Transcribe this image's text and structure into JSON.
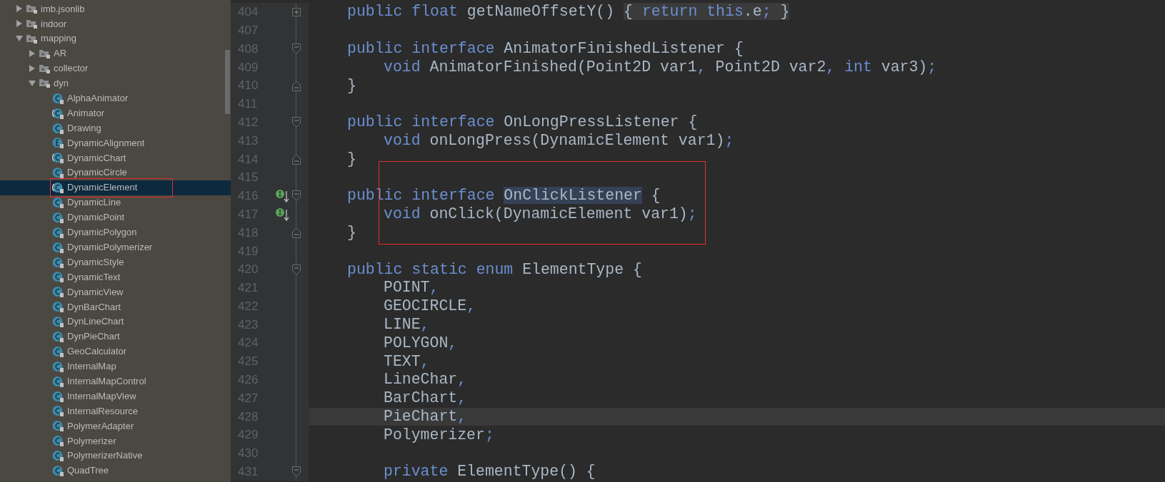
{
  "project_tree": [
    {
      "label": "imb.jsonlib",
      "kind": "package",
      "expanded": false,
      "selected": false,
      "marked": false
    },
    {
      "label": "indoor",
      "kind": "package",
      "expanded": false,
      "selected": false,
      "marked": false
    },
    {
      "label": "mapping",
      "kind": "package",
      "expanded": true,
      "selected": false,
      "marked": false,
      "children": [
        {
          "label": "AR",
          "kind": "package",
          "expanded": false,
          "selected": false,
          "marked": false
        },
        {
          "label": "collector",
          "kind": "package",
          "expanded": false,
          "selected": false,
          "marked": false
        },
        {
          "label": "dyn",
          "kind": "package",
          "expanded": true,
          "selected": false,
          "marked": false,
          "children": [
            {
              "label": "AlphaAnimator",
              "kind": "class",
              "selected": false,
              "marked": false
            },
            {
              "label": "Animator",
              "kind": "abstract",
              "selected": false,
              "marked": false
            },
            {
              "label": "Drawing",
              "kind": "class",
              "selected": false,
              "marked": false
            },
            {
              "label": "DynamicAlignment",
              "kind": "enum",
              "selected": false,
              "marked": false
            },
            {
              "label": "DynamicChart",
              "kind": "abstract",
              "selected": false,
              "marked": false
            },
            {
              "label": "DynamicCircle",
              "kind": "class",
              "selected": false,
              "marked": false
            },
            {
              "label": "DynamicElement",
              "kind": "abstract",
              "selected": true,
              "marked": true
            },
            {
              "label": "DynamicLine",
              "kind": "class",
              "selected": false,
              "marked": false
            },
            {
              "label": "DynamicPoint",
              "kind": "class",
              "selected": false,
              "marked": false
            },
            {
              "label": "DynamicPolygon",
              "kind": "class",
              "selected": false,
              "marked": false
            },
            {
              "label": "DynamicPolymerizer",
              "kind": "class",
              "selected": false,
              "marked": false
            },
            {
              "label": "DynamicStyle",
              "kind": "class",
              "selected": false,
              "marked": false
            },
            {
              "label": "DynamicText",
              "kind": "class",
              "selected": false,
              "marked": false
            },
            {
              "label": "DynamicView",
              "kind": "class",
              "selected": false,
              "marked": false
            },
            {
              "label": "DynBarChart",
              "kind": "class",
              "selected": false,
              "marked": false
            },
            {
              "label": "DynLineChart",
              "kind": "class",
              "selected": false,
              "marked": false
            },
            {
              "label": "DynPieChart",
              "kind": "class",
              "selected": false,
              "marked": false
            },
            {
              "label": "GeoCalculator",
              "kind": "class",
              "selected": false,
              "marked": false
            },
            {
              "label": "InternalMap",
              "kind": "class",
              "selected": false,
              "marked": false
            },
            {
              "label": "InternalMapControl",
              "kind": "class",
              "selected": false,
              "marked": false
            },
            {
              "label": "InternalMapView",
              "kind": "class",
              "selected": false,
              "marked": false
            },
            {
              "label": "InternalResource",
              "kind": "class",
              "selected": false,
              "marked": false
            },
            {
              "label": "PolymerAdapter",
              "kind": "class",
              "selected": false,
              "marked": false
            },
            {
              "label": "Polymerizer",
              "kind": "class",
              "selected": false,
              "marked": false
            },
            {
              "label": "PolymerizerNative",
              "kind": "class",
              "selected": false,
              "marked": false
            },
            {
              "label": "QuadTree",
              "kind": "class",
              "selected": false,
              "marked": false
            }
          ]
        }
      ]
    }
  ],
  "editor": {
    "lines": [
      {
        "number": "404",
        "fold": {
          "kind": "folded"
        },
        "indented": false,
        "implemented": false,
        "current": false,
        "marked": false,
        "segments": [
          {
            "text": "public float",
            "kind": "keyword"
          },
          {
            "text": " getNameOffsetY() ",
            "kind": "plain"
          },
          {
            "text": "{ ",
            "kind": "plain",
            "folded": true
          },
          {
            "text": "return this",
            "kind": "keyword",
            "folded": true
          },
          {
            "text": ".e",
            "kind": "plain",
            "folded": true
          },
          {
            "text": ";",
            "kind": "keyword",
            "folded": true
          },
          {
            "text": " }",
            "kind": "plain",
            "folded": true
          }
        ]
      },
      {
        "number": "407",
        "implemented": false,
        "current": false,
        "marked": false
      },
      {
        "number": "408",
        "fold": {
          "kind": "start"
        },
        "indented": false,
        "implemented": false,
        "current": false,
        "marked": false,
        "segments": [
          {
            "text": "public interface",
            "kind": "keyword"
          },
          {
            "text": " AnimatorFinishedListener {",
            "kind": "plain"
          }
        ]
      },
      {
        "number": "409",
        "indented": true,
        "implemented": false,
        "current": false,
        "marked": false,
        "segments": [
          {
            "text": "void",
            "kind": "keyword"
          },
          {
            "text": " AnimatorFinished(Point2D var1",
            "kind": "plain"
          },
          {
            "text": ",",
            "kind": "keyword"
          },
          {
            "text": " Point2D var2",
            "kind": "plain"
          },
          {
            "text": ", int",
            "kind": "keyword"
          },
          {
            "text": " var3)",
            "kind": "plain"
          },
          {
            "text": ";",
            "kind": "keyword"
          }
        ]
      },
      {
        "number": "410",
        "fold": {
          "kind": "end"
        },
        "indented": false,
        "implemented": false,
        "current": false,
        "marked": false,
        "segments": [
          {
            "text": "}",
            "kind": "plain"
          }
        ]
      },
      {
        "number": "411",
        "implemented": false,
        "current": false,
        "marked": false
      },
      {
        "number": "412",
        "fold": {
          "kind": "start"
        },
        "indented": false,
        "implemented": false,
        "current": false,
        "marked": false,
        "segments": [
          {
            "text": "public interface",
            "kind": "keyword"
          },
          {
            "text": " OnLongPressListener {",
            "kind": "plain"
          }
        ]
      },
      {
        "number": "413",
        "indented": true,
        "implemented": false,
        "current": false,
        "marked": false,
        "segments": [
          {
            "text": "void",
            "kind": "keyword"
          },
          {
            "text": " onLongPress(DynamicElement var1)",
            "kind": "plain"
          },
          {
            "text": ";",
            "kind": "keyword"
          }
        ]
      },
      {
        "number": "414",
        "fold": {
          "kind": "end"
        },
        "indented": false,
        "implemented": false,
        "current": false,
        "marked": false,
        "segments": [
          {
            "text": "}",
            "kind": "plain"
          }
        ]
      },
      {
        "number": "415",
        "implemented": false,
        "current": false,
        "marked": true
      },
      {
        "number": "416",
        "fold": {
          "kind": "start"
        },
        "indented": false,
        "implemented": true,
        "current": false,
        "marked": true,
        "segments": [
          {
            "text": "public interface ",
            "kind": "keyword"
          },
          {
            "text": "OnClickListener",
            "kind": "reference"
          },
          {
            "text": " {",
            "kind": "plain"
          }
        ]
      },
      {
        "number": "417",
        "indented": true,
        "implemented": true,
        "current": false,
        "marked": true,
        "segments": [
          {
            "text": "void",
            "kind": "keyword"
          },
          {
            "text": " onClick(DynamicElement var1)",
            "kind": "plain"
          },
          {
            "text": ";",
            "kind": "keyword"
          }
        ]
      },
      {
        "number": "418",
        "fold": {
          "kind": "end"
        },
        "indented": false,
        "implemented": false,
        "current": false,
        "marked": true,
        "segments": [
          {
            "text": "}",
            "kind": "plain"
          }
        ]
      },
      {
        "number": "419",
        "implemented": false,
        "current": false,
        "marked": false
      },
      {
        "number": "420",
        "fold": {
          "kind": "start"
        },
        "indented": false,
        "implemented": false,
        "current": false,
        "marked": false,
        "segments": [
          {
            "text": "public static enum",
            "kind": "keyword"
          },
          {
            "text": " ElementType {",
            "kind": "plain"
          }
        ]
      },
      {
        "number": "421",
        "indented": true,
        "implemented": false,
        "current": false,
        "marked": false,
        "segments": [
          {
            "text": "POINT",
            "kind": "plain"
          },
          {
            "text": ",",
            "kind": "keyword"
          }
        ]
      },
      {
        "number": "422",
        "indented": true,
        "implemented": false,
        "current": false,
        "marked": false,
        "segments": [
          {
            "text": "GEOCIRCLE",
            "kind": "plain"
          },
          {
            "text": ",",
            "kind": "keyword"
          }
        ]
      },
      {
        "number": "423",
        "indented": true,
        "implemented": false,
        "current": false,
        "marked": false,
        "segments": [
          {
            "text": "LINE",
            "kind": "plain"
          },
          {
            "text": ",",
            "kind": "keyword"
          }
        ]
      },
      {
        "number": "424",
        "indented": true,
        "implemented": false,
        "current": false,
        "marked": false,
        "segments": [
          {
            "text": "POLYGON",
            "kind": "plain"
          },
          {
            "text": ",",
            "kind": "keyword"
          }
        ]
      },
      {
        "number": "425",
        "indented": true,
        "implemented": false,
        "current": false,
        "marked": false,
        "segments": [
          {
            "text": "TEXT",
            "kind": "plain"
          },
          {
            "text": ",",
            "kind": "keyword"
          }
        ]
      },
      {
        "number": "426",
        "indented": true,
        "implemented": false,
        "current": false,
        "marked": false,
        "segments": [
          {
            "text": "LineChar",
            "kind": "plain"
          },
          {
            "text": ",",
            "kind": "keyword"
          }
        ]
      },
      {
        "number": "427",
        "indented": true,
        "implemented": false,
        "current": false,
        "marked": false,
        "segments": [
          {
            "text": "BarChart",
            "kind": "plain"
          },
          {
            "text": ",",
            "kind": "keyword"
          }
        ]
      },
      {
        "number": "428",
        "indented": true,
        "implemented": false,
        "current": true,
        "marked": false,
        "segments": [
          {
            "text": "PieChart",
            "kind": "plain"
          },
          {
            "text": ",",
            "kind": "keyword"
          }
        ]
      },
      {
        "number": "429",
        "indented": true,
        "implemented": false,
        "current": false,
        "marked": false,
        "segments": [
          {
            "text": "Polymerizer",
            "kind": "plain"
          },
          {
            "text": ";",
            "kind": "keyword"
          }
        ]
      },
      {
        "number": "430",
        "implemented": false,
        "current": false,
        "marked": false
      },
      {
        "number": "431",
        "fold": {
          "kind": "start"
        },
        "indented": true,
        "implemented": false,
        "current": false,
        "marked": false,
        "segments": [
          {
            "text": "private",
            "kind": "keyword"
          },
          {
            "text": " ElementType() {",
            "kind": "plain"
          }
        ]
      }
    ]
  }
}
